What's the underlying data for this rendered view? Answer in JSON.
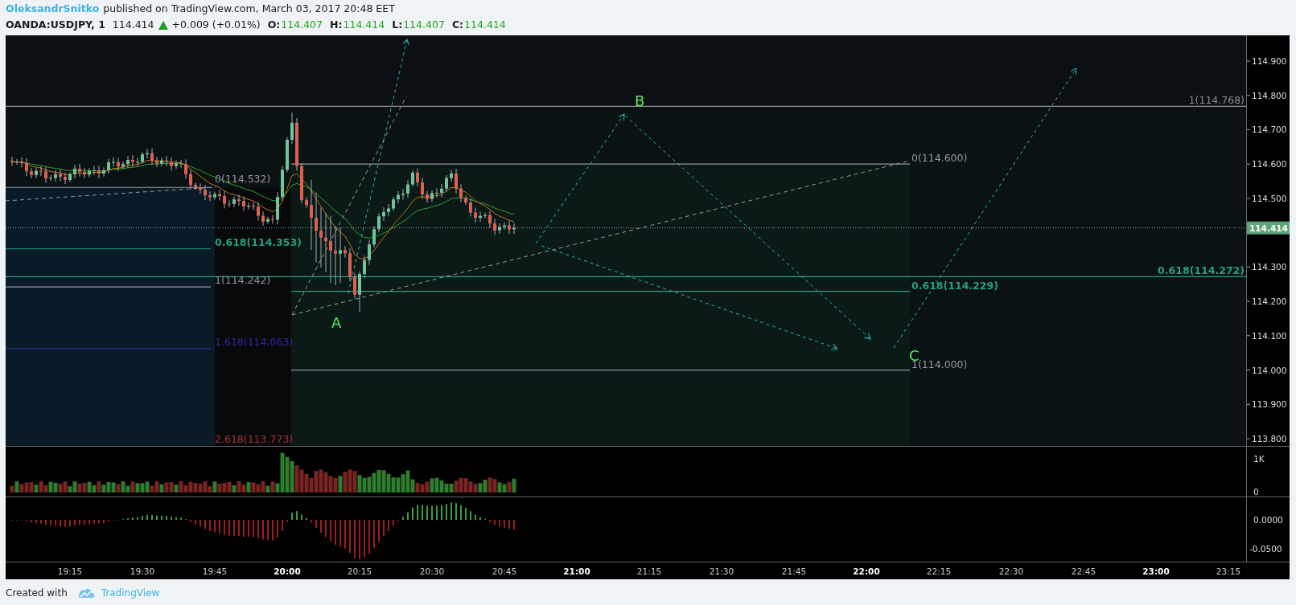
{
  "header": {
    "author": "OleksandrSnitko",
    "published": "published on TradingView.com, March 03, 2017 20:48 EET"
  },
  "symbol_bar": {
    "symbol": "OANDA:USDJPY, 1",
    "price": "114.414",
    "up": true,
    "change": "+0.009 (+0.01%)",
    "ohlc": [
      {
        "label": "O:",
        "value": "114.407"
      },
      {
        "label": "H:",
        "value": "114.414"
      },
      {
        "label": "L:",
        "value": "114.407"
      },
      {
        "label": "C:",
        "value": "114.414"
      }
    ]
  },
  "price_chart": {
    "price_axis": [
      "114.900",
      "114.800",
      "114.700",
      "114.600",
      "114.500",
      "114.300",
      "114.200",
      "114.100",
      "114.000",
      "113.900",
      "113.800"
    ],
    "last_price": "114.414",
    "fib_levels": [
      {
        "text": "0(114.532)",
        "color": "#9598a1"
      },
      {
        "text": "0.618(114.353)",
        "color": "#26a17b"
      },
      {
        "text": "1(114.242)",
        "color": "#9598a1"
      },
      {
        "text": "1.618(114.063)",
        "color": "#2a2aa0"
      },
      {
        "text": "2.618(113.773)",
        "color": "#a83232"
      },
      {
        "text": "0(114.600)",
        "color": "#9598a1"
      },
      {
        "text": "0.618(114.229)",
        "color": "#26a17b"
      },
      {
        "text": "1(114.000)",
        "color": "#9598a1"
      },
      {
        "text": "1(114.768)",
        "color": "#8a8d96"
      },
      {
        "text": "0.618(114.272)",
        "color": "#26a17b"
      }
    ],
    "wave_labels": [
      "A",
      "B",
      "C"
    ]
  },
  "volume_panel": {
    "axis": [
      "1K",
      "0"
    ]
  },
  "oscillator_panel": {
    "axis": [
      "0.0000",
      "-0.0500"
    ]
  },
  "time_axis": [
    {
      "label": "19:15",
      "bold": false
    },
    {
      "label": "19:30",
      "bold": false
    },
    {
      "label": "19:45",
      "bold": false
    },
    {
      "label": "20:00",
      "bold": true
    },
    {
      "label": "20:15",
      "bold": false
    },
    {
      "label": "20:30",
      "bold": false
    },
    {
      "label": "20:45",
      "bold": false
    },
    {
      "label": "21:00",
      "bold": true
    },
    {
      "label": "21:15",
      "bold": false
    },
    {
      "label": "21:30",
      "bold": false
    },
    {
      "label": "21:45",
      "bold": false
    },
    {
      "label": "22:00",
      "bold": true
    },
    {
      "label": "22:15",
      "bold": false
    },
    {
      "label": "22:30",
      "bold": false
    },
    {
      "label": "22:45",
      "bold": false
    },
    {
      "label": "23:00",
      "bold": true
    },
    {
      "label": "23:15",
      "bold": false
    }
  ],
  "footer": {
    "text": "Created with",
    "brand": "TradingView"
  }
}
